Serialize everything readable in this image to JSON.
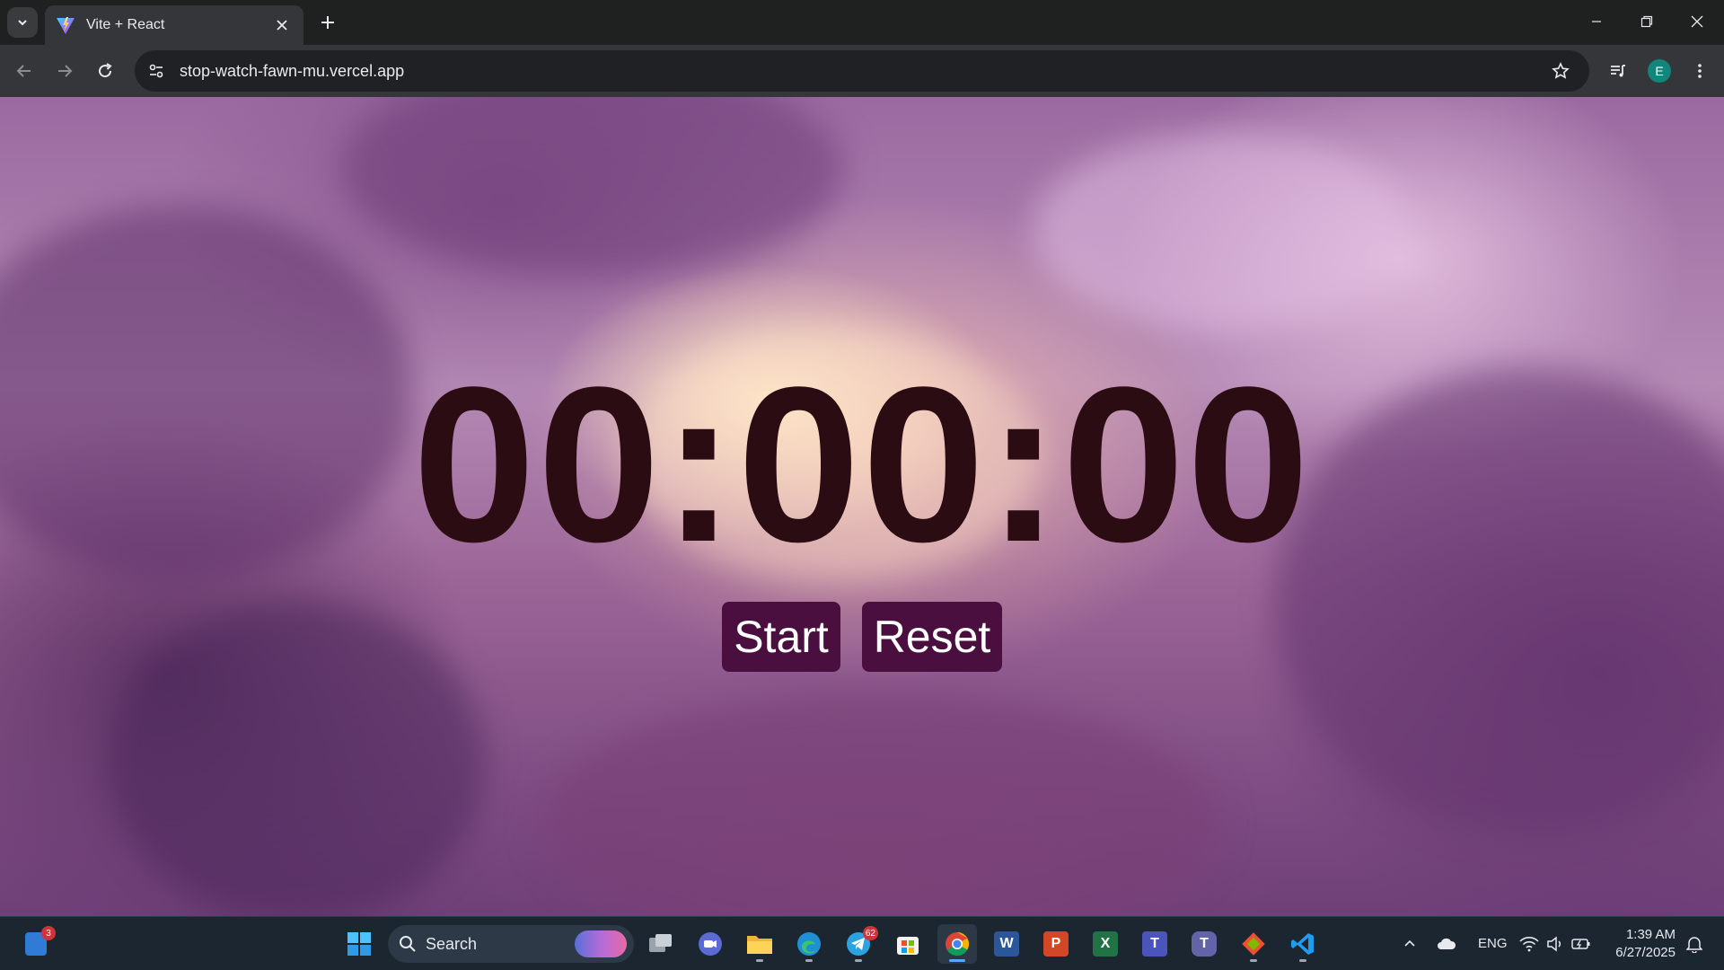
{
  "browser": {
    "tab_title": "Vite + React",
    "url": "stop-watch-fawn-mu.vercel.app",
    "profile_initial": "E"
  },
  "page": {
    "timer": "00:00:00",
    "start_label": "Start",
    "reset_label": "Reset",
    "colors": {
      "timer_text": "#2a0c12",
      "button_bg": "#4a0f3e",
      "button_text": "#ffffff"
    }
  },
  "taskbar": {
    "search_label": "Search",
    "widget_badge": "3",
    "telegram_badge": "62",
    "language": "ENG",
    "time": "1:39 AM",
    "date": "6/27/2025",
    "pinned": [
      "windows-start",
      "search",
      "task-view",
      "zoom",
      "file-explorer",
      "edge",
      "telegram",
      "microsoft-store",
      "chrome",
      "word",
      "powerpoint",
      "excel",
      "teams-classic",
      "teams",
      "git-gui",
      "vscode"
    ]
  }
}
